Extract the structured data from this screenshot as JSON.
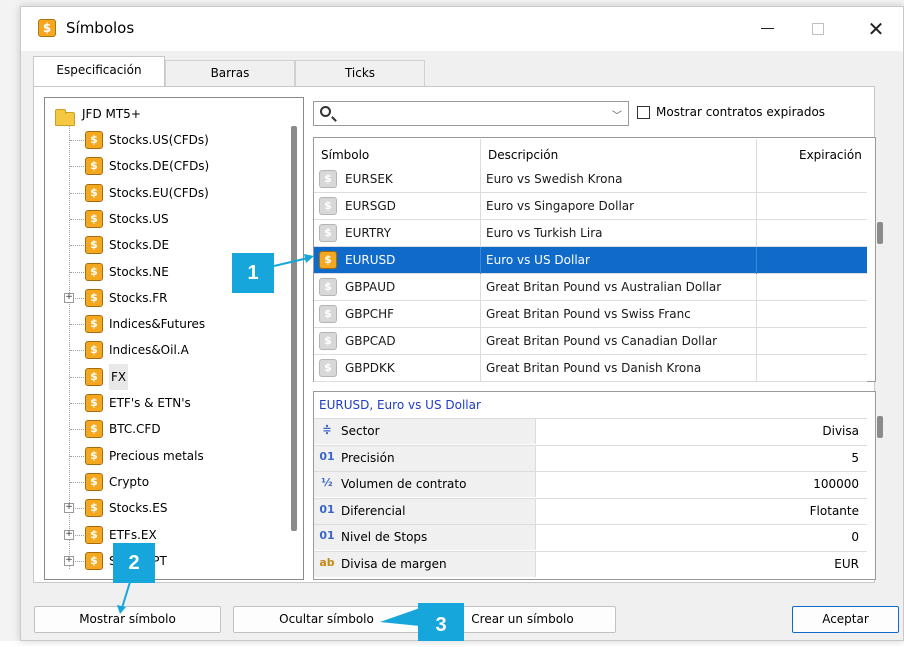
{
  "window": {
    "title": "Símbolos",
    "title_icon": "dollar-coin-icon"
  },
  "tabs": [
    {
      "label": "Especificación",
      "active": true
    },
    {
      "label": "Barras",
      "active": false
    },
    {
      "label": "Ticks",
      "active": false
    }
  ],
  "tree": {
    "root": "JFD MT5+",
    "items": [
      {
        "label": "Stocks.US(CFDs)",
        "expandable": false
      },
      {
        "label": "Stocks.DE(CFDs)",
        "expandable": false
      },
      {
        "label": "Stocks.EU(CFDs)",
        "expandable": false
      },
      {
        "label": "Stocks.US",
        "expandable": false
      },
      {
        "label": "Stocks.DE",
        "expandable": false
      },
      {
        "label": "Stocks.NE",
        "expandable": false
      },
      {
        "label": "Stocks.FR",
        "expandable": true
      },
      {
        "label": "Indices&Futures",
        "expandable": false
      },
      {
        "label": "Indices&Oil.A",
        "expandable": false
      },
      {
        "label": "FX",
        "expandable": false,
        "selected": true
      },
      {
        "label": "ETF's & ETN's",
        "expandable": false
      },
      {
        "label": "BTC.CFD",
        "expandable": false
      },
      {
        "label": "Precious metals",
        "expandable": false
      },
      {
        "label": "Crypto",
        "expandable": false
      },
      {
        "label": "Stocks.ES",
        "expandable": true
      },
      {
        "label": "ETFs.EX",
        "expandable": true
      },
      {
        "label": "Stocks.PT",
        "expandable": true
      }
    ]
  },
  "search": {
    "value": "",
    "placeholder": ""
  },
  "show_expired": {
    "label": "Mostrar contratos expirados",
    "checked": false
  },
  "symbols_table": {
    "columns": [
      "Símbolo",
      "Descripción",
      "Expiración"
    ],
    "rows": [
      {
        "symbol": "EURSEK",
        "description": "Euro vs Swedish Krona",
        "expiration": "",
        "active_icon": false
      },
      {
        "symbol": "EURSGD",
        "description": "Euro vs Singapore Dollar",
        "expiration": "",
        "active_icon": false
      },
      {
        "symbol": "EURTRY",
        "description": "Euro vs Turkish Lira",
        "expiration": "",
        "active_icon": false
      },
      {
        "symbol": "EURUSD",
        "description": "Euro vs US Dollar",
        "expiration": "",
        "active_icon": true,
        "selected": true
      },
      {
        "symbol": "GBPAUD",
        "description": "Great Britan Pound vs Australian Dollar",
        "expiration": "",
        "active_icon": false
      },
      {
        "symbol": "GBPCHF",
        "description": "Great Britan Pound vs Swiss Franc",
        "expiration": "",
        "active_icon": false
      },
      {
        "symbol": "GBPCAD",
        "description": "Great Britan Pound vs Canadian Dollar",
        "expiration": "",
        "active_icon": false
      },
      {
        "symbol": "GBPDKK",
        "description": "Great Britan Pound vs Danish Krona",
        "expiration": "",
        "active_icon": false
      }
    ]
  },
  "properties": {
    "title": "EURUSD, Euro vs US Dollar",
    "rows": [
      {
        "icon": "≑",
        "icon_name": "sector-icon",
        "label": "Sector",
        "value": "Divisa"
      },
      {
        "icon": "01",
        "icon_name": "digits-icon",
        "label": "Precisión",
        "value": "5"
      },
      {
        "icon": "½",
        "icon_name": "fraction-icon",
        "label": "Volumen de contrato",
        "value": "100000"
      },
      {
        "icon": "01",
        "icon_name": "digits-icon",
        "label": "Diferencial",
        "value": "Flotante"
      },
      {
        "icon": "01",
        "icon_name": "digits-icon",
        "label": "Nivel de Stops",
        "value": "0"
      },
      {
        "icon": "ab",
        "icon_name": "text-icon",
        "label": "Divisa de margen",
        "value": "EUR"
      }
    ]
  },
  "buttons": {
    "show": "Mostrar símbolo",
    "hide": "Ocultar símbolo",
    "create": "Crear un símbolo",
    "ok": "Aceptar"
  },
  "callouts": [
    "1",
    "2",
    "3"
  ],
  "colors": {
    "selection": "#0f6ac9",
    "callout": "#17a6dc",
    "coin": "#f4a81f"
  }
}
